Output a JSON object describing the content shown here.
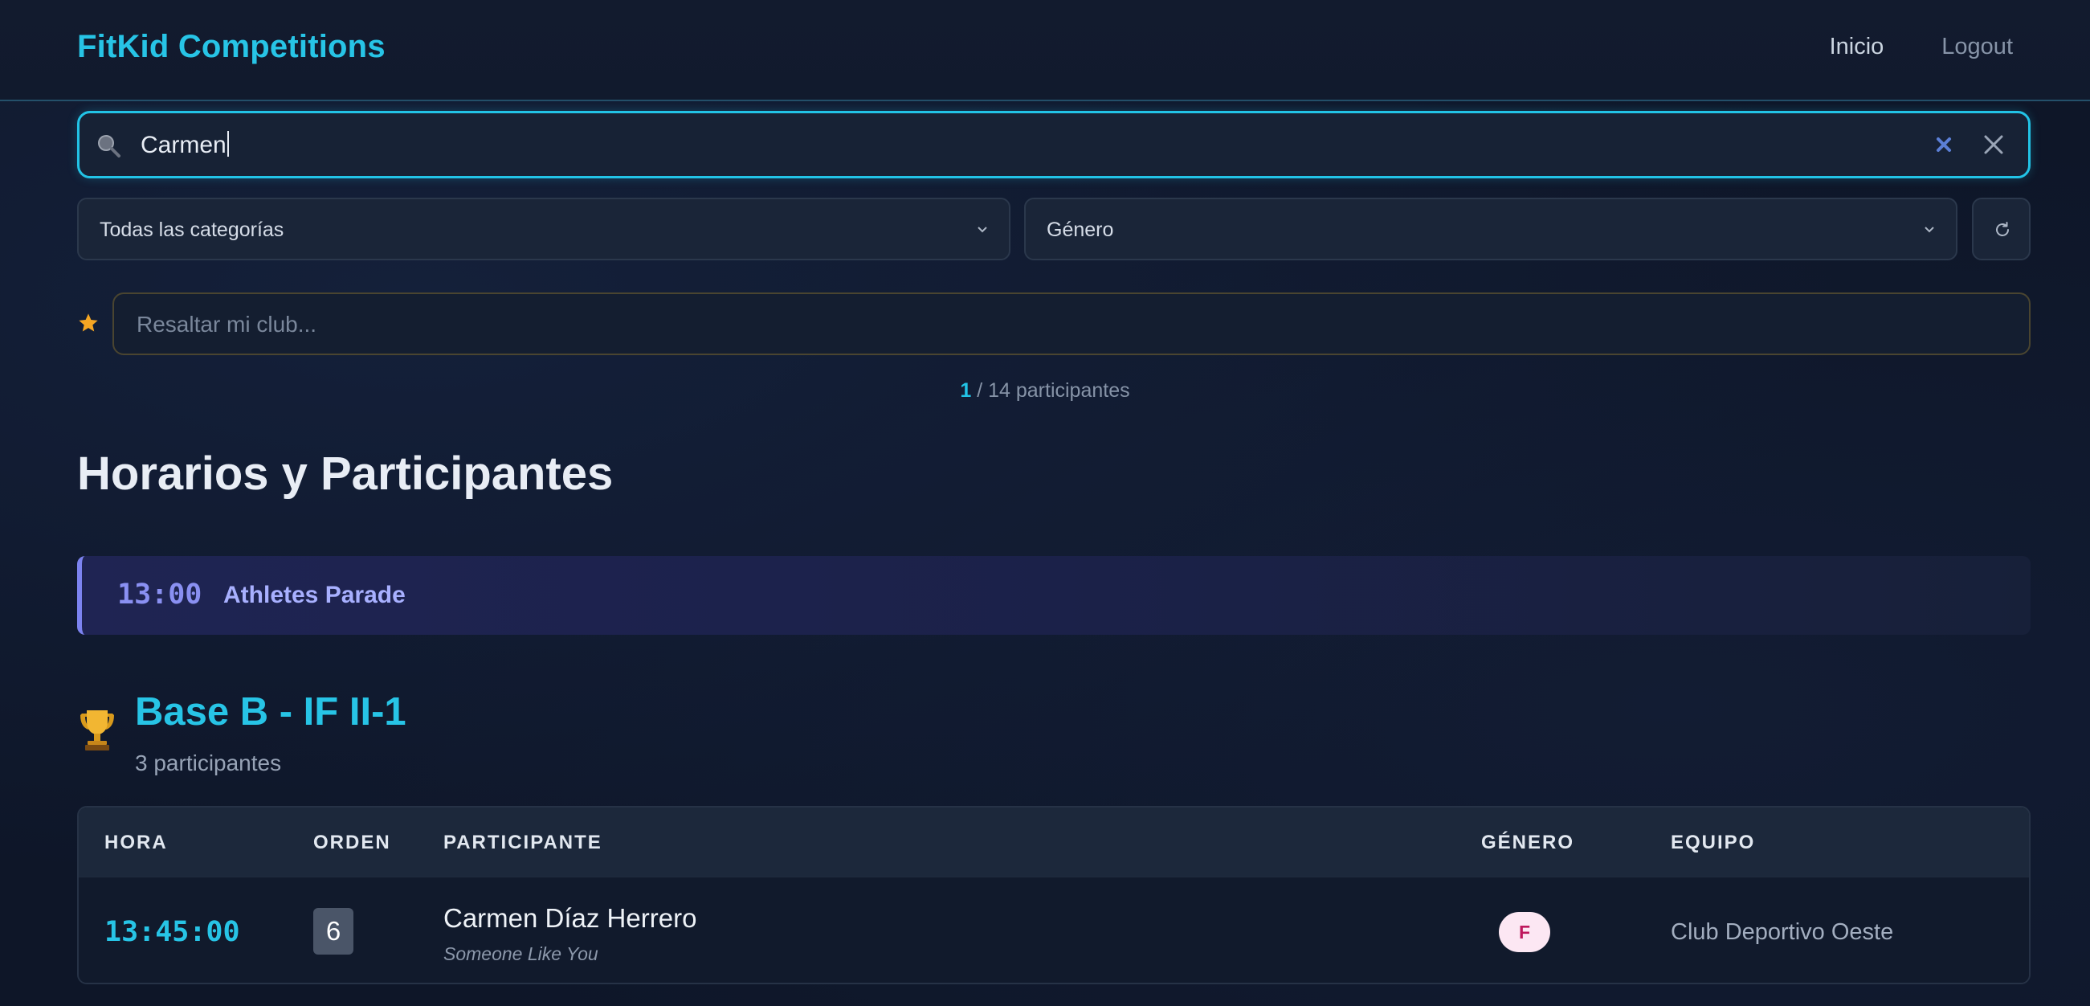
{
  "header": {
    "brand": "FitKid Competitions",
    "nav": [
      {
        "label": "Inicio"
      },
      {
        "label": "Logout"
      }
    ]
  },
  "search": {
    "value": "Carmen",
    "icon": "search-icon"
  },
  "filters": {
    "category": {
      "selected": "Todas las categorías"
    },
    "gender": {
      "selected": "Género"
    },
    "refresh_icon": "refresh-icon"
  },
  "club_highlight": {
    "placeholder": "Resaltar mi club...",
    "icon": "star-icon"
  },
  "results": {
    "current": "1",
    "total": "14 participantes",
    "separator": " / "
  },
  "page_title": "Horarios y Participantes",
  "event": {
    "time": "13:00",
    "title": "Athletes Parade"
  },
  "category": {
    "icon": "trophy-icon",
    "name": "Base B - IF II-1",
    "count": "3 participantes"
  },
  "table": {
    "columns": [
      "HORA",
      "ORDEN",
      "PARTICIPANTE",
      "GÉNERO",
      "EQUIPO"
    ],
    "rows": [
      {
        "hora": "13:45:00",
        "orden": "6",
        "participante": "Carmen Díaz Herrero",
        "cancion": "Someone Like You",
        "genero": "F",
        "equipo": "Club Deportivo Oeste"
      }
    ]
  },
  "colors": {
    "accent": "#27c4e6",
    "event_accent": "#7c83f0",
    "gender_f_bg": "#fce7f3",
    "gender_f_text": "#be185d"
  }
}
